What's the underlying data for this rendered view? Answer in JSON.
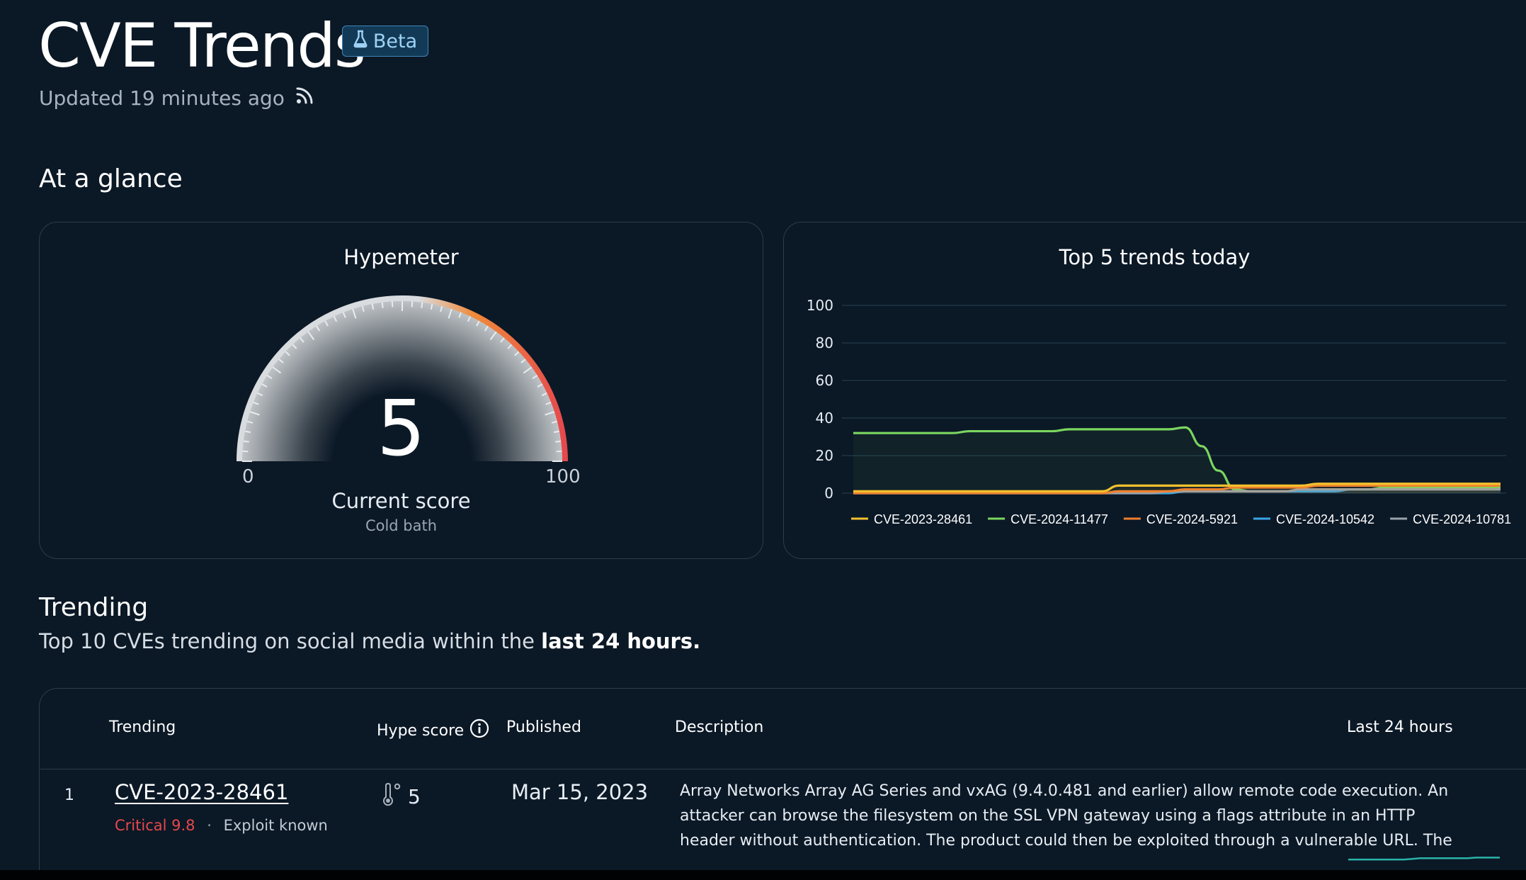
{
  "header": {
    "title": "CVE Trends",
    "badge_label": "Beta",
    "updated_text": "Updated 19 minutes ago"
  },
  "at_a_glance": {
    "heading": "At a glance",
    "hypemeter": {
      "title": "Hypemeter",
      "score": "5",
      "min_label": "0",
      "max_label": "100",
      "score_label": "Current score",
      "status": "Cold bath",
      "score_fraction": 0.05
    }
  },
  "top5": {
    "title": "Top 5 trends today"
  },
  "chart_data": {
    "type": "line",
    "title": "Top 5 trends today",
    "xlabel": "",
    "ylabel": "",
    "ylim": [
      0,
      100
    ],
    "yticks": [
      0,
      20,
      40,
      60,
      80,
      100
    ],
    "grid": true,
    "legend": "bottom",
    "series": [
      {
        "name": "CVE-2023-28461",
        "color": "#f2c12e",
        "values": [
          1,
          1,
          1,
          1,
          1,
          1,
          1,
          1,
          1,
          1,
          1,
          1,
          1,
          1,
          1,
          1,
          4,
          4,
          4,
          4,
          4,
          4,
          4,
          4,
          4,
          4,
          4,
          4,
          5,
          5,
          5,
          5,
          5,
          5,
          5,
          5,
          5,
          5,
          5,
          5
        ]
      },
      {
        "name": "CVE-2024-11477",
        "color": "#7bd65f",
        "values": [
          32,
          32,
          32,
          32,
          32,
          32,
          32,
          33,
          33,
          33,
          33,
          33,
          33,
          34,
          34,
          34,
          34,
          34,
          34,
          34,
          35,
          25,
          12,
          2,
          1,
          1,
          1,
          2,
          2,
          2,
          2,
          2,
          3,
          3,
          3,
          3,
          3,
          3,
          3,
          3
        ]
      },
      {
        "name": "CVE-2024-5921",
        "color": "#f07f2f",
        "values": [
          0,
          0,
          0,
          0,
          0,
          0,
          0,
          0,
          0,
          0,
          0,
          0,
          0,
          0,
          0,
          0,
          1,
          1,
          1,
          1,
          2,
          2,
          2,
          3,
          3,
          3,
          3,
          3,
          4,
          4,
          4,
          4,
          4,
          4,
          4,
          4,
          4,
          4,
          4,
          4
        ]
      },
      {
        "name": "CVE-2024-10542",
        "color": "#39a6e6",
        "values": [
          0,
          0,
          0,
          0,
          0,
          0,
          0,
          0,
          0,
          0,
          0,
          0,
          0,
          0,
          0,
          0,
          0,
          0,
          0,
          0,
          1,
          1,
          1,
          1,
          1,
          1,
          1,
          1,
          1,
          1,
          2,
          2,
          2,
          2,
          2,
          2,
          2,
          2,
          2,
          2
        ]
      },
      {
        "name": "CVE-2024-10781",
        "color": "#9aa3ad",
        "values": [
          0,
          0,
          0,
          0,
          0,
          0,
          0,
          0,
          0,
          0,
          0,
          0,
          0,
          0,
          0,
          0,
          0,
          0,
          0,
          1,
          1,
          1,
          1,
          1,
          1,
          1,
          1,
          2,
          2,
          2,
          2,
          2,
          2,
          2,
          2,
          2,
          2,
          2,
          2,
          2
        ]
      }
    ]
  },
  "trending": {
    "heading": "Trending",
    "desc_prefix": "Top 10 CVEs trending on social media within the",
    "desc_emphasis": "last 24 hours."
  },
  "table": {
    "columns": {
      "trending": "Trending",
      "hype": "Hype score",
      "published": "Published",
      "description": "Description",
      "last24": "Last 24 hours"
    },
    "rows": [
      {
        "rank": "1",
        "cve": "CVE-2023-28461",
        "severity": "Critical 9.8",
        "separator": "·",
        "exploit": "Exploit known",
        "hype": "5",
        "published": "Mar 15, 2023",
        "description_lines": [
          "Array Networks Array AG Series and vxAG (9.4.0.481 and earlier) allow remote code execution. An",
          "attacker can browse the filesystem on the SSL VPN gateway using a flags attribute in an HTTP",
          "header without authentication. The product could then be exploited through a vulnerable URL. The"
        ],
        "sparkline": [
          1,
          1,
          1,
          1,
          1,
          1,
          1,
          1,
          2,
          3,
          3,
          3,
          3,
          3,
          3,
          3,
          4,
          4,
          4,
          4
        ]
      }
    ]
  },
  "colors": {
    "background": "#0b1826",
    "card_border": "#2d3c4b",
    "badge_bg": "#123a57",
    "critical": "#e5484d",
    "sparkline": "#2bb3a8"
  }
}
